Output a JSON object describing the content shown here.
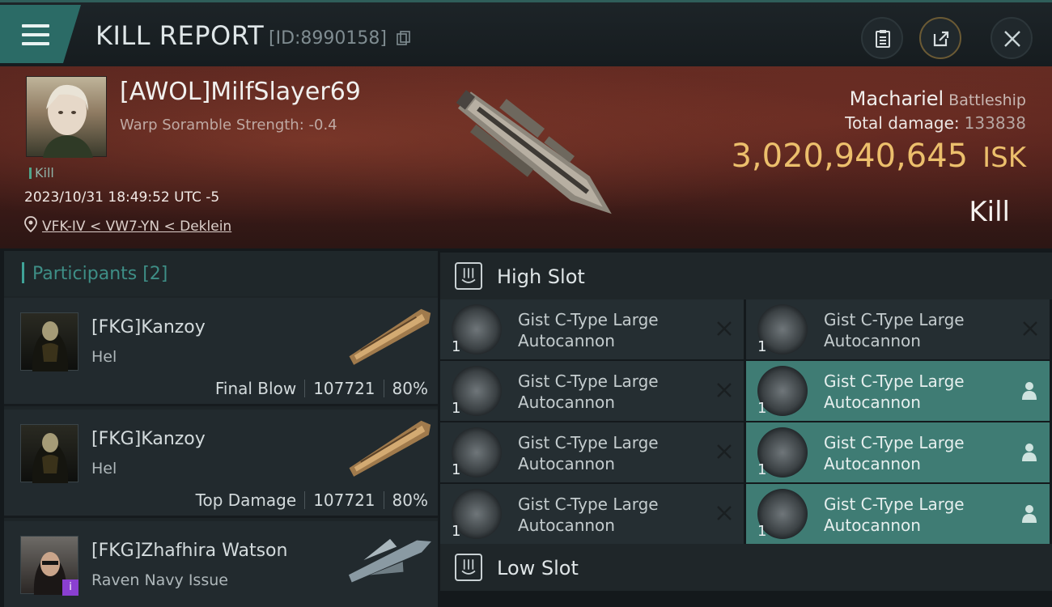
{
  "header": {
    "title": "KILL REPORT",
    "id_text": "[ID:8990158]"
  },
  "victim": {
    "name": "[AWOL]MilfSlayer69",
    "scramble": "Warp Soramble Strength: -0.4",
    "kill_tag": "Kill",
    "timestamp": "2023/10/31 18:49:52 UTC -5",
    "location": "VFK-IV < VW7-YN < Deklein"
  },
  "ship": {
    "name": "Machariel",
    "class": "Battleship",
    "total_damage_label": "Total damage:",
    "total_damage": "133838",
    "isk_value": "3,020,940,645",
    "isk_unit": "ISK",
    "result": "Kill"
  },
  "participants": {
    "title": "Participants [2]",
    "rows": [
      {
        "name": "[FKG]Kanzoy",
        "ship": "Hel",
        "role": "Final Blow",
        "damage": "107721",
        "percent": "80%"
      },
      {
        "name": "[FKG]Kanzoy",
        "ship": "Hel",
        "role": "Top Damage",
        "damage": "107721",
        "percent": "80%"
      },
      {
        "name": "[FKG]Zhafhira Watson",
        "ship": "Raven Navy Issue",
        "badge": "i"
      }
    ]
  },
  "fittings": {
    "high_slot_title": "High Slot",
    "low_slot_title": "Low Slot",
    "modules": [
      {
        "line1": "Gist C-Type Large",
        "line2": "Autocannon",
        "qty": "1"
      },
      {
        "line1": "Gist C-Type Large",
        "line2": "Autocannon",
        "qty": "1"
      },
      {
        "line1": "Gist C-Type Large",
        "line2": "Autocannon",
        "qty": "1"
      },
      {
        "line1": "Gist C-Type Large",
        "line2": "Autocannon",
        "qty": "1"
      },
      {
        "line1": "Gist C-Type Large",
        "line2": "Autocannon",
        "qty": "1"
      },
      {
        "line1": "Gist C-Type Large",
        "line2": "Autocannon",
        "qty": "1"
      },
      {
        "line1": "Gist C-Type Large",
        "line2": "Autocannon",
        "qty": "1"
      },
      {
        "line1": "Gist C-Type Large",
        "line2": "Autocannon",
        "qty": "1"
      }
    ]
  },
  "colors": {
    "accent": "#3fa398",
    "isk": "#ecbf6c",
    "banner": "#5c2720",
    "active_module": "#3f7c74"
  }
}
